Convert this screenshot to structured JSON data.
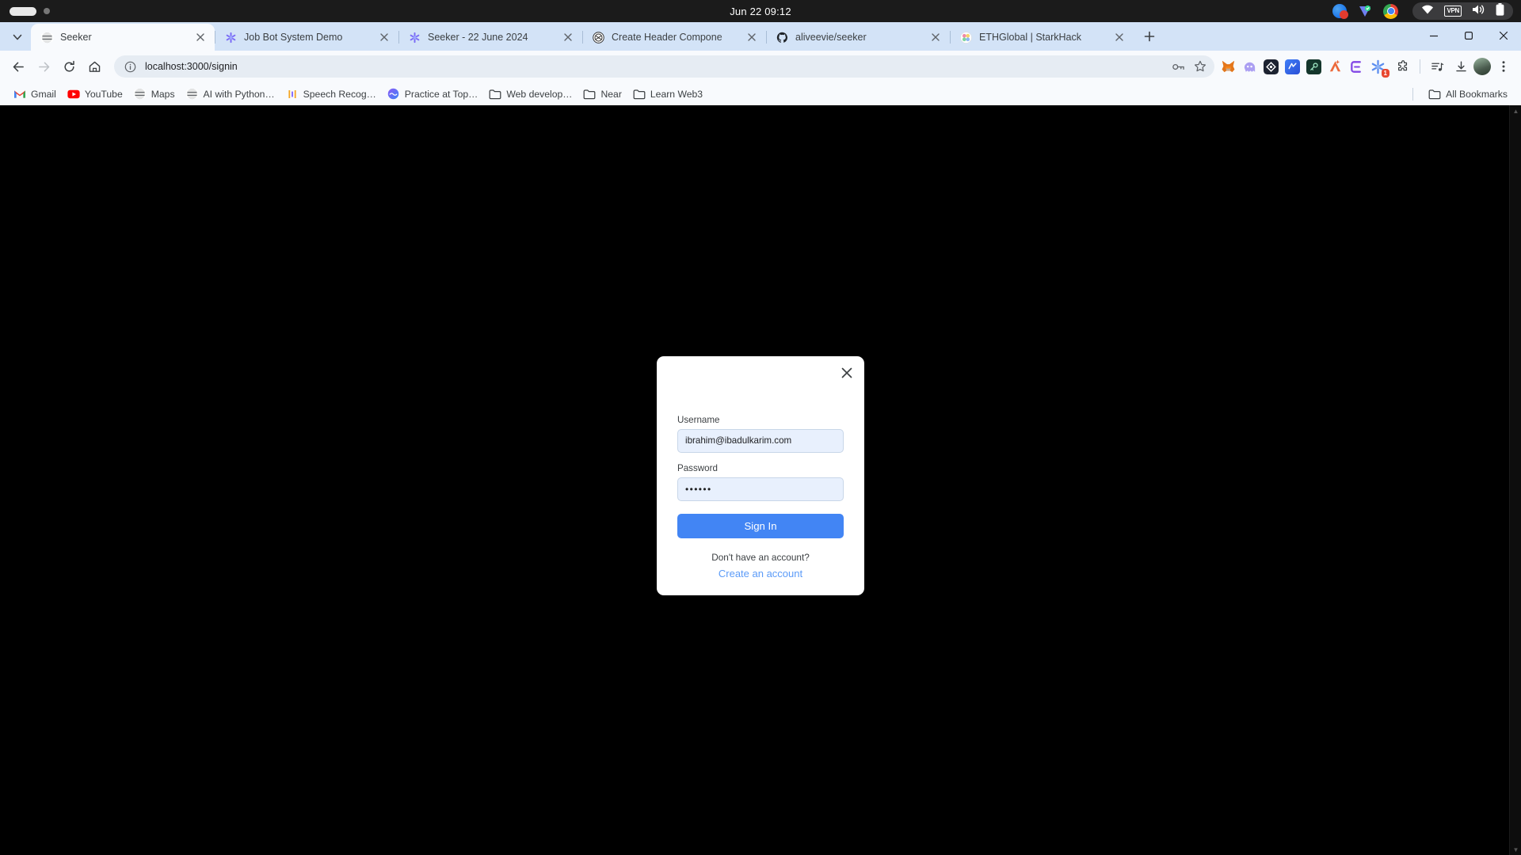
{
  "os": {
    "clock": "Jun 22  09:12",
    "tray": [
      {
        "name": "chat-badge-icon",
        "label": "0"
      },
      {
        "name": "verification-icon",
        "label": "V"
      },
      {
        "name": "chrome-icon",
        "label": "Chrome"
      }
    ],
    "status": [
      {
        "name": "wifi-icon",
        "label": "Wi-Fi"
      },
      {
        "name": "vpn-icon",
        "label": "VPN"
      },
      {
        "name": "volume-icon",
        "label": "Volume"
      },
      {
        "name": "battery-icon",
        "label": "Battery"
      }
    ]
  },
  "browser": {
    "tab_list_button": "Search tabs",
    "new_tab_button": "New tab",
    "tabs": [
      {
        "title": "Seeker",
        "favicon": "globe-icon",
        "active": true
      },
      {
        "title": "Job Bot System Demo",
        "favicon": "notion-asterisk-icon",
        "active": false
      },
      {
        "title": "Seeker - 22 June 2024",
        "favicon": "notion-asterisk-icon",
        "active": false
      },
      {
        "title": "Create Header Compone",
        "favicon": "chatgpt-icon",
        "active": false
      },
      {
        "title": "aliveevie/seeker",
        "favicon": "github-icon",
        "active": false
      },
      {
        "title": "ETHGlobal | StarkHack",
        "favicon": "ethglobal-icon",
        "active": false
      }
    ],
    "window_controls": {
      "minimize": "Minimize",
      "maximize": "Maximize",
      "close": "Close"
    },
    "nav": {
      "back": "Back",
      "forward": "Forward",
      "reload": "Reload",
      "home": "Home"
    },
    "omnibox": {
      "url": "localhost:3000/signin",
      "site_info": "View site information",
      "password_manager": "Password manager",
      "bookmark": "Bookmark this tab"
    },
    "extensions": [
      {
        "name": "metamask-extension-icon",
        "label": "MetaMask"
      },
      {
        "name": "phantom-extension-icon",
        "label": "Phantom"
      },
      {
        "name": "rabby-extension-icon",
        "label": "Rabby"
      },
      {
        "name": "argent-extension-icon",
        "label": "Argent X"
      },
      {
        "name": "keyring-extension-icon",
        "label": "Keyring"
      },
      {
        "name": "adobe-extension-icon",
        "label": "Adobe Acrobat"
      },
      {
        "name": "enkrypt-extension-icon",
        "label": "Enkrypt"
      },
      {
        "name": "notion-extension-icon",
        "label": "Notion Web Clipper",
        "badge": "1"
      }
    ],
    "toolbar_right": [
      {
        "name": "extensions-puzzle-icon",
        "label": "Extensions"
      },
      {
        "name": "reading-list-icon",
        "label": "Reading list"
      },
      {
        "name": "downloads-icon",
        "label": "Downloads"
      },
      {
        "name": "profile-avatar",
        "label": "Profile"
      },
      {
        "name": "chrome-menu-icon",
        "label": "Customize and control Google Chrome"
      }
    ],
    "bookmarks": [
      {
        "label": "Gmail",
        "icon": "gmail-icon"
      },
      {
        "label": "YouTube",
        "icon": "youtube-icon"
      },
      {
        "label": "Maps",
        "icon": "globe-icon"
      },
      {
        "label": "AI with Python…",
        "icon": "globe-icon"
      },
      {
        "label": "Speech Recog…",
        "icon": "speech-bars-icon"
      },
      {
        "label": "Practice at Top…",
        "icon": "gradient-circle-icon"
      },
      {
        "label": "Web develop…",
        "icon": "folder-icon"
      },
      {
        "label": "Near",
        "icon": "folder-icon"
      },
      {
        "label": "Learn Web3",
        "icon": "folder-icon"
      }
    ],
    "all_bookmarks": {
      "label": "All Bookmarks",
      "icon": "folder-icon"
    }
  },
  "modal": {
    "close_label": "×",
    "username": {
      "label": "Username",
      "value": "ibrahim@ibadulkarim.com",
      "placeholder": "Username"
    },
    "password": {
      "label": "Password",
      "value": "••••••",
      "placeholder": "Password"
    },
    "submit_label": "Sign In",
    "footer_text": "Don't have an account?",
    "footer_link": "Create an account"
  },
  "colors": {
    "accent_blue": "#4285f4",
    "link_blue": "#5b9bf8",
    "input_bg": "#e8f0fd",
    "page_bg": "#000000",
    "chrome_tabstrip": "#d3e3f7",
    "chrome_toolbar": "#f8fafd"
  }
}
